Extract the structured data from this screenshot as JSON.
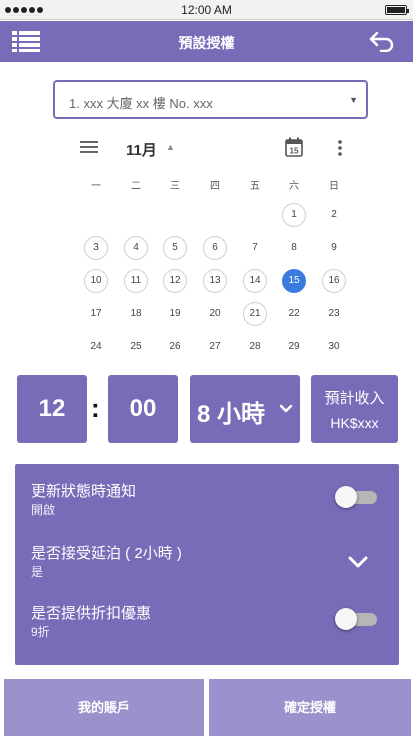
{
  "status_bar": {
    "time": "12:00 AM",
    "signal_icon": "signal-dots-icon",
    "battery_icon": "battery-icon"
  },
  "header": {
    "title": "預設授權",
    "menu_icon": "list-menu-icon",
    "back_icon": "back-arrow-icon"
  },
  "address_select": {
    "selected": "1. xxx 大廈 xx 樓 No. xxx"
  },
  "calendar": {
    "month_label": "11月",
    "weekdays": [
      "一",
      "二",
      "三",
      "四",
      "五",
      "六",
      "日"
    ],
    "today": 15,
    "days": [
      {
        "n": "1",
        "ring": true
      },
      {
        "n": "2",
        "ring": false
      },
      {
        "n": "3",
        "ring": true
      },
      {
        "n": "4",
        "ring": true
      },
      {
        "n": "5",
        "ring": true
      },
      {
        "n": "6",
        "ring": true
      },
      {
        "n": "7",
        "ring": false
      },
      {
        "n": "8",
        "ring": false
      },
      {
        "n": "9",
        "ring": false
      },
      {
        "n": "10",
        "ring": true
      },
      {
        "n": "11",
        "ring": true
      },
      {
        "n": "12",
        "ring": true
      },
      {
        "n": "13",
        "ring": true
      },
      {
        "n": "14",
        "ring": true
      },
      {
        "n": "15",
        "ring": false
      },
      {
        "n": "16",
        "ring": true
      },
      {
        "n": "17",
        "ring": false
      },
      {
        "n": "18",
        "ring": false
      },
      {
        "n": "19",
        "ring": false
      },
      {
        "n": "20",
        "ring": false
      },
      {
        "n": "21",
        "ring": true
      },
      {
        "n": "22",
        "ring": false
      },
      {
        "n": "23",
        "ring": false
      },
      {
        "n": "24",
        "ring": false
      },
      {
        "n": "25",
        "ring": false
      },
      {
        "n": "26",
        "ring": false
      },
      {
        "n": "27",
        "ring": false
      },
      {
        "n": "28",
        "ring": false
      },
      {
        "n": "29",
        "ring": false
      },
      {
        "n": "30",
        "ring": false
      }
    ]
  },
  "time_picker": {
    "hour": "12",
    "separator": ":",
    "minute": "00",
    "duration": "8 小時",
    "income_label": "預計收入",
    "income_value": "HK$xxx"
  },
  "settings": {
    "items": [
      {
        "title": "更新狀態時通知",
        "subtitle": "開啟",
        "control": "toggle",
        "on": false
      },
      {
        "title": "是否接受延泊 ( 2小時 )",
        "subtitle": "是",
        "control": "chevron"
      },
      {
        "title": "是否提供折扣優惠",
        "subtitle": "9折",
        "control": "toggle",
        "on": false
      }
    ]
  },
  "footer": {
    "account_label": "我的賬戶",
    "confirm_label": "確定授權"
  },
  "colors": {
    "accent": "#7a6bb9",
    "button_light": "#9c91cd",
    "today": "#3a7be0"
  }
}
